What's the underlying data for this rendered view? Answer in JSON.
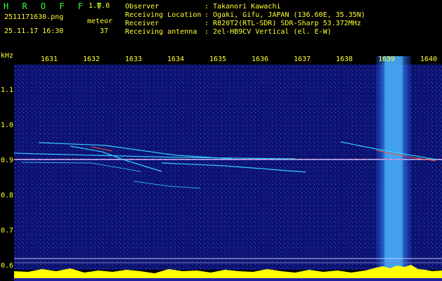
{
  "app": {
    "title": "H R O F F T",
    "version": "1.0.0"
  },
  "file": {
    "name": "2511171630.png",
    "timestamp": "25.11.17 16:30"
  },
  "meteor": {
    "label": "meteor",
    "count": "37"
  },
  "info": [
    {
      "key": "Observer",
      "value": ": Takanori Kawachi"
    },
    {
      "key": "Receiving Location",
      "value": ": Ogaki, Gifu, JAPAN (136.60E, 35.35N)"
    },
    {
      "key": "Receiver",
      "value": ": R820T2(RTL-SDR) SDR-Sharp 53.372MHz"
    },
    {
      "key": "Receiving antenna",
      "value": ": 2el-HB9CV Vertical (el. E-W)"
    }
  ],
  "axis": {
    "unit": "kHz",
    "x_ticks": [
      "1631",
      "1632",
      "1633",
      "1634",
      "1635",
      "1636",
      "1637",
      "1638",
      "1639",
      "1640"
    ],
    "y_ticks": [
      "1.1",
      "1.0",
      "0.9",
      "0.8",
      "0.7",
      "0.6"
    ]
  },
  "colors": {
    "background": "#000000",
    "waterfall_bg": "#0a0f6e",
    "text": "#ffff33",
    "title": "#33ff33",
    "signal_line": "#ff5533",
    "meteor_trail": "#33ccff",
    "noise_band": "#2a8cff",
    "level_bar": "#ffff00"
  }
}
